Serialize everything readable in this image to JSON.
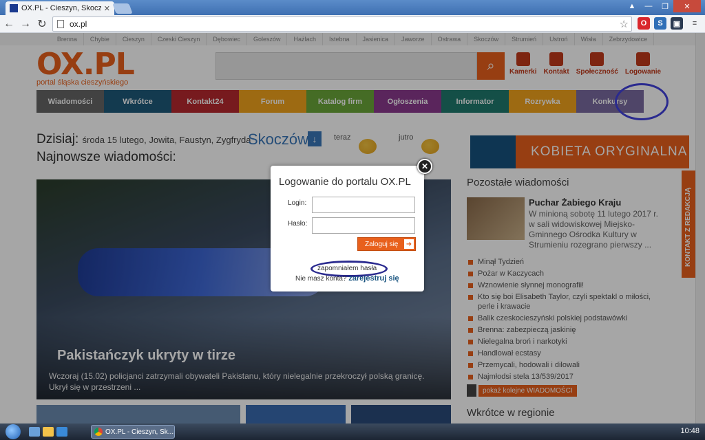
{
  "browser": {
    "tab_title": "OX.PL - Cieszyn, Skoczów",
    "url": "ox.pl"
  },
  "site": {
    "towns": [
      "Brenna",
      "Chybie",
      "Cieszyn",
      "Czeski Cieszyn",
      "Dębowiec",
      "Goleszów",
      "Hażlach",
      "Istebna",
      "Jasienica",
      "Jaworze",
      "Ostrawa",
      "Skoczów",
      "Strumień",
      "Ustroń",
      "Wisła",
      "Zebrzydowice"
    ],
    "logo": "OX.PL",
    "tagline": "portal śląska cieszyńskiego",
    "top_icons": [
      "Kamerki",
      "Kontakt",
      "Społeczność",
      "Logowanie"
    ],
    "nav": [
      {
        "label": "Wiadomości",
        "color": "#666666"
      },
      {
        "label": "Wkrótce",
        "color": "#1e5a7a"
      },
      {
        "label": "Kontakt24",
        "color": "#b7282e"
      },
      {
        "label": "Forum",
        "color": "#f2a41c"
      },
      {
        "label": "Katalog firm",
        "color": "#6aa63a"
      },
      {
        "label": "Ogłoszenia",
        "color": "#8a3a8e"
      },
      {
        "label": "Informator",
        "color": "#1f7a6e"
      },
      {
        "label": "Rozrywka",
        "color": "#f2a41c"
      },
      {
        "label": "Konkursy",
        "color": "#7a6aa0"
      }
    ],
    "today_label": "Dzisiaj:",
    "today_date": "środa 15 lutego, Jowita, Faustyn, Zygfryda",
    "city": "Skoczów",
    "weather_now": "teraz",
    "weather_tomorrow": "jutro",
    "newest_heading": "Najnowsze wiadomości:",
    "hero_title": "Pakistańczyk ukryty w tirze",
    "hero_text": "Wczoraj (15.02) policjanci zatrzymali obywateli Pakistanu, który nielegalnie przekroczył polską granicę. Ukrył się w przestrzeni ...",
    "banner": "KOBIETA ORYGINALNA",
    "other_news_heading": "Pozostałe wiadomości",
    "featured_title": "Puchar Żabiego Kraju",
    "featured_text": "W minioną sobotę 11 lutego 2017 r. w sali widowiskowej Miejsko-Gminnego Ośrodka Kultury w Strumieniu rozegrano pierwszy ...",
    "headlines": [
      "Minął Tydzień",
      "Pożar w Kaczycach",
      "Wznowienie słynnej monografii!",
      "Kto się boi Elisabeth Taylor, czyli spektakl o miłości, perle i krawacie",
      "Balik czeskocieszyński polskiej podstawówki",
      "Brenna: zabezpieczą jaskinię",
      "Nielegalna broń i narkotyki",
      "Handlował ecstasy",
      "Przemycali, hodowali i dilowali",
      "Najmłodsi stela 13/539/2017"
    ],
    "more_button": "pokaż kolejne WIADOMOŚCI",
    "region_heading": "Wkrótce w regionie",
    "sidetab": "KONTAKT Z REDAKCJĄ"
  },
  "login_modal": {
    "title": "Logowanie do portalu OX.PL",
    "login_label": "Login:",
    "password_label": "Hasło:",
    "login_value": "",
    "password_value": "",
    "submit": "Zaloguj się",
    "forgot": "zapomniałem hasła",
    "no_account": "Nie masz konta?",
    "register": "zarejestruj się"
  },
  "taskbar": {
    "task": "OX.PL - Cieszyn, Sk...",
    "clock": "10:48"
  },
  "colors": {
    "accent": "#e8601c",
    "annotation_ring": "#2a2a8f"
  }
}
